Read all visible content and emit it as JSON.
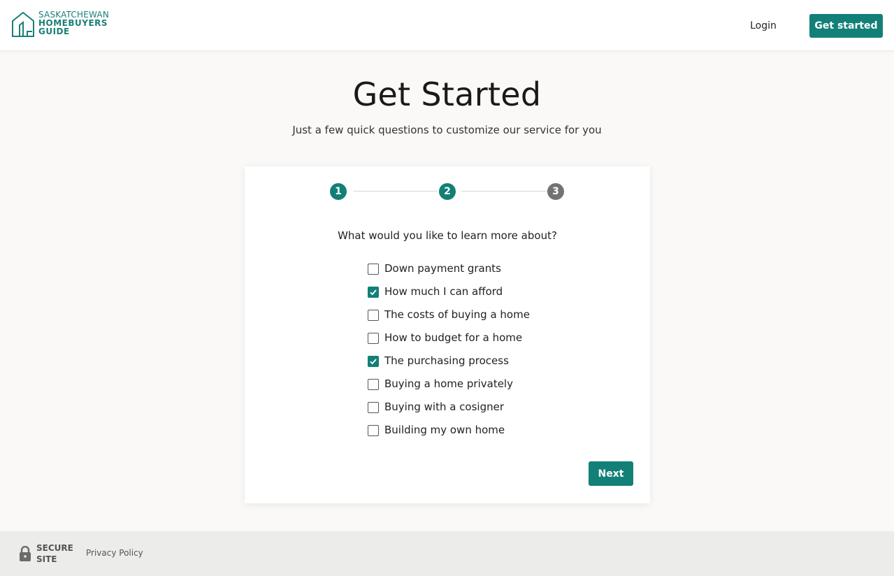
{
  "header": {
    "logo": {
      "line1": "SASKATCHEWAN",
      "line2": "HOMEBUYERS",
      "line3": "GUIDE"
    },
    "login_label": "Login",
    "get_started_label": "Get started"
  },
  "main": {
    "title": "Get Started",
    "subtitle": "Just a few quick questions to customize our service for you"
  },
  "card": {
    "steps": [
      {
        "label": "1",
        "state": "done"
      },
      {
        "label": "2",
        "state": "done"
      },
      {
        "label": "3",
        "state": "todo"
      }
    ],
    "question": "What would you like to learn more about?",
    "options": [
      {
        "label": "Down payment grants",
        "checked": false
      },
      {
        "label": "How much I can afford",
        "checked": true
      },
      {
        "label": "The costs of buying a home",
        "checked": false
      },
      {
        "label": "How to budget for a home",
        "checked": false
      },
      {
        "label": "The purchasing process",
        "checked": true
      },
      {
        "label": "Buying a home privately",
        "checked": false
      },
      {
        "label": "Buying with a cosigner",
        "checked": false
      },
      {
        "label": "Building my own home",
        "checked": false
      }
    ],
    "next_label": "Next"
  },
  "footer": {
    "secure_line1": "SECURE",
    "secure_line2": "SITE",
    "privacy_label": "Privacy Policy"
  },
  "colors": {
    "accent": "#128077",
    "step_inactive": "#737373",
    "page_bg": "#faf9f7",
    "footer_bg": "#ececea"
  },
  "icons": {
    "logo": "house-outline-icon",
    "checkbox_checked": "check-icon",
    "footer": "lock-icon"
  }
}
